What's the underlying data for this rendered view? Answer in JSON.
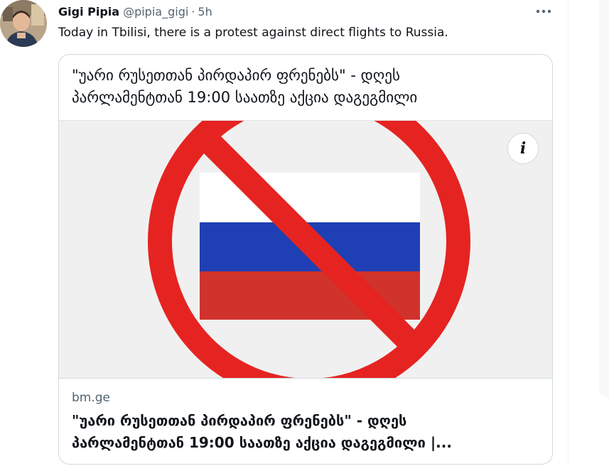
{
  "tweet": {
    "author_name": "Gigi Pipia",
    "author_handle": "@pipia_gigi",
    "separator": "·",
    "time": "5h",
    "text": "Today in Tbilisi, there is a protest against direct flights to Russia.",
    "more_icon": "more-horizontal-icon"
  },
  "card": {
    "headline": "\"უარი რუსეთთან პირდაპირ ფრენებს\" - დღეს პარლამენტთან 19:00 საათზე აქცია დაგეგმილი",
    "domain": "bm.ge",
    "title_line1": "\"უარი რუსეთთან პირდაპირ ფრენებს\" - დღეს",
    "title_line2": "პარლამენტთან 19:00 საათზე აქცია დაგეგმილი |...",
    "headline_line1": "\"უარი რუსეთთან პირდაპირ ფრენებს\" - დღეს",
    "headline_line2": "პარლამენტთან 19:00 საათზე აქცია დაგეგმილი",
    "info_label": "i",
    "image_icon": "prohibited-russian-flag-image"
  },
  "colors": {
    "prohibit_red": "#e52421",
    "flag_white": "#ffffff",
    "flag_blue": "#1f3fb4",
    "flag_red": "#d0332b",
    "image_bg": "#f0f0f0",
    "secondary_text": "#536471",
    "border": "#cfd9de"
  }
}
